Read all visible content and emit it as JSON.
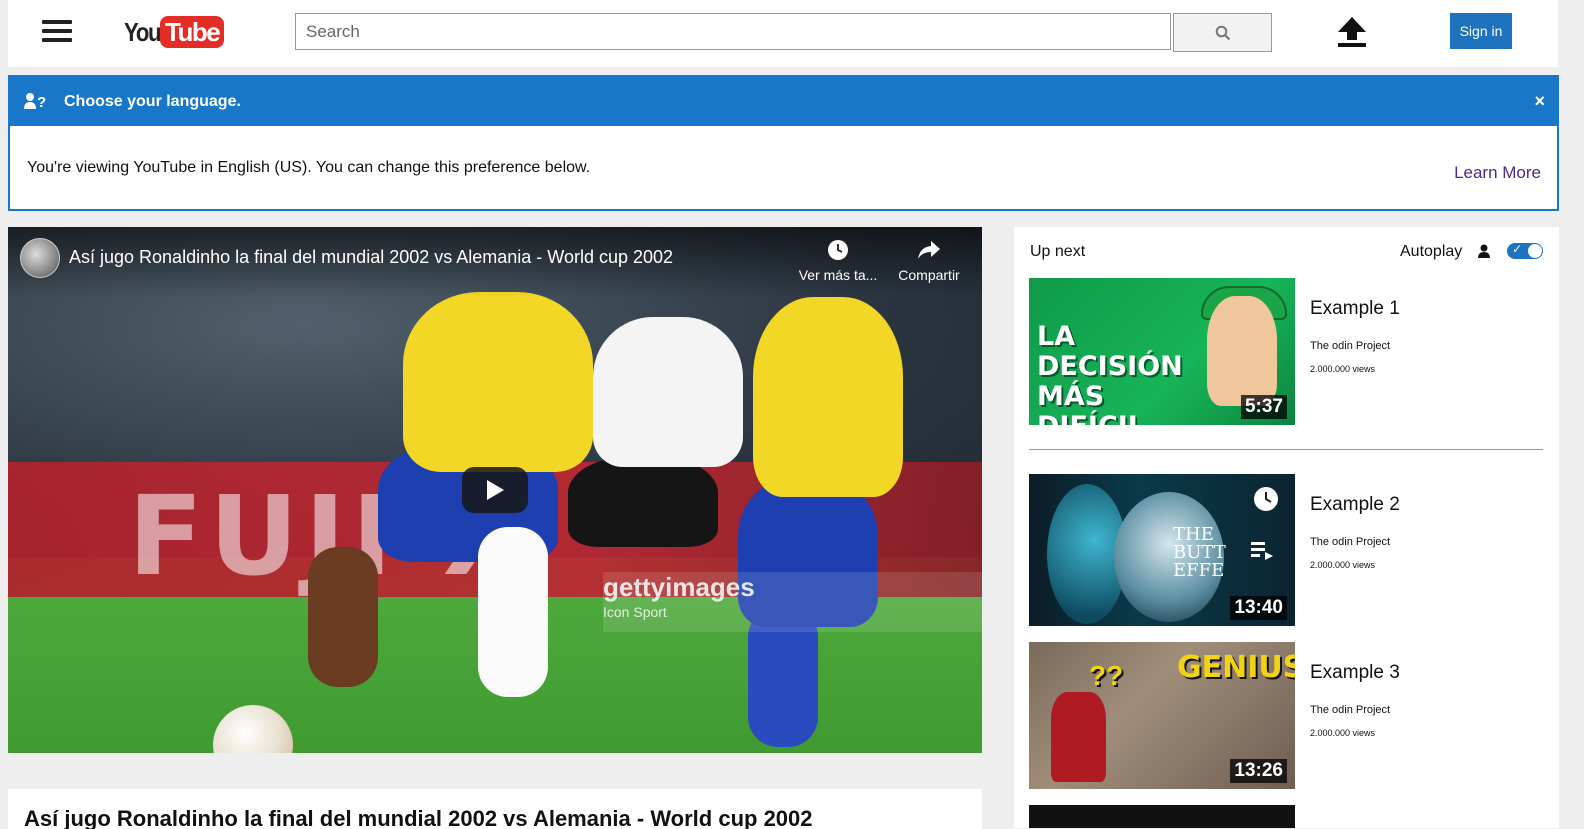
{
  "header": {
    "logo_you": "You",
    "logo_tube": "Tube",
    "search_placeholder": "Search",
    "signin_label": "Sign in"
  },
  "language_banner": {
    "title": "Choose your language.",
    "message": "You're viewing YouTube in English (US). You can change this preference below.",
    "learn_more": "Learn More",
    "close_label": "×"
  },
  "video": {
    "title": "Así jugo Ronaldinho la final del mundial 2002 vs Alemania - World cup 2002",
    "watch_later_label": "Ver más ta...",
    "share_label": "Compartir",
    "watermark_brand": "gettyimages",
    "watermark_sub": "Icon Sport",
    "board_text": "FUJI X"
  },
  "below_video": {
    "title": "Así jugo Ronaldinho la final del mundial 2002 vs Alemania - World cup 2002"
  },
  "sidebar": {
    "up_next": "Up next",
    "autoplay": "Autoplay",
    "autoplay_on": true,
    "items": [
      {
        "title": "Example 1",
        "channel": "The odin Project",
        "views": "2.000.000 views",
        "duration": "5:37",
        "thumb_text": "LA DECISIÓN MÁS DIFÍCIL"
      },
      {
        "title": "Example 2",
        "channel": "The odin Project",
        "views": "2.000.000 views",
        "duration": "13:40",
        "thumb_text": "THE BUTT EFFE"
      },
      {
        "title": "Example 3",
        "channel": "The odin Project",
        "views": "2.000.000 views",
        "duration": "13:26",
        "thumb_text": "GENIUS"
      }
    ]
  },
  "colors": {
    "accent_blue": "#1877c9",
    "signin_blue": "#1e73be",
    "logo_red": "#e52d27",
    "learn_more": "#4a2a8a",
    "page_bg": "#eeeeee"
  },
  "icons": {
    "menu": "hamburger-icon",
    "search": "search-icon",
    "upload": "upload-icon",
    "language_user": "user-question-icon",
    "close": "close-icon",
    "watch_later": "clock-icon",
    "share": "share-arrow-icon",
    "play": "play-icon",
    "autoplay_user": "user-icon"
  }
}
